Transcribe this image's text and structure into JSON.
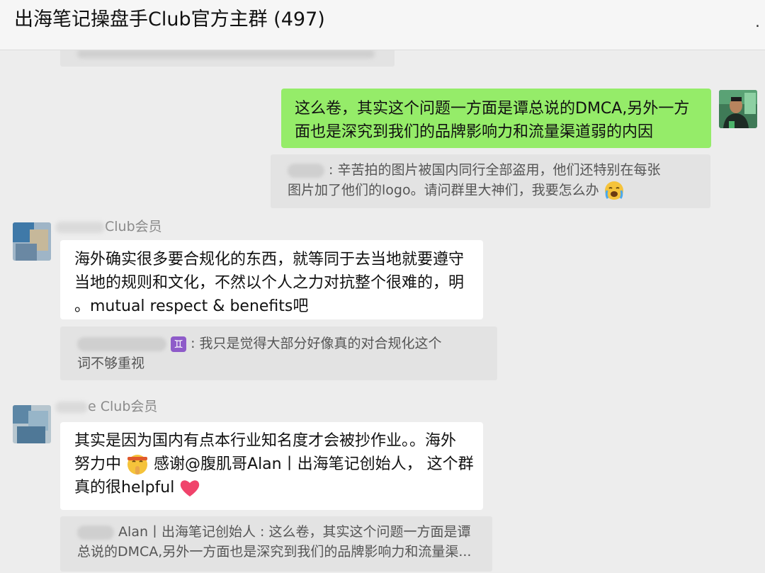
{
  "header": {
    "title": "出海笔记操盘手Club官方主群 (497)",
    "more_icon": "."
  },
  "messages": {
    "top_quote": {
      "text": "…"
    },
    "m1": {
      "text_line1": "这么卷，其实这个问题一方面是谭总说的DMCA,另外一方",
      "text_line2": "面也是深究到我们的品牌影响力和流量渠道弱的内因",
      "quote_line1": ":  辛苦拍的图片被国内同行全部盗用，他们还特别在每张",
      "quote_line2": "图片加了他们的logo。请问群里大神们，我要怎么办"
    },
    "m2": {
      "sender_suffix": "Club会员",
      "line1": "海外确实很多要合规化的东西，就等同于去当地就要遵守",
      "line2": "当地的规则和文化，不然以个人之力对抗整个很难的，明",
      "line3": "。mutual respect & benefits吧",
      "quote_badge": "♊",
      "quote_line1": ":  我只是觉得大部分好像真的对合规化这个",
      "quote_line2": "词不够重视"
    },
    "m3": {
      "sender_suffix": "e Club会员",
      "line1": "其实是因为国内有点本行业知名度才会被抄作业。。海外",
      "line2a": "努力中",
      "line2b": "感谢@腹肌哥Alan丨出海笔记创始人，  这个群",
      "line3": "真的很helpful",
      "quote_line1": "Alan丨出海笔记创始人 :  这么卷，其实这个问题一方面是谭",
      "quote_line2": "总说的DMCA,另外一方面也是深究到我们的品牌影响力和流量渠..."
    }
  },
  "colors": {
    "bg": "#ededed",
    "self_bubble": "#95ec69",
    "other_bubble": "#ffffff",
    "quote_bg": "#e3e3e3"
  }
}
